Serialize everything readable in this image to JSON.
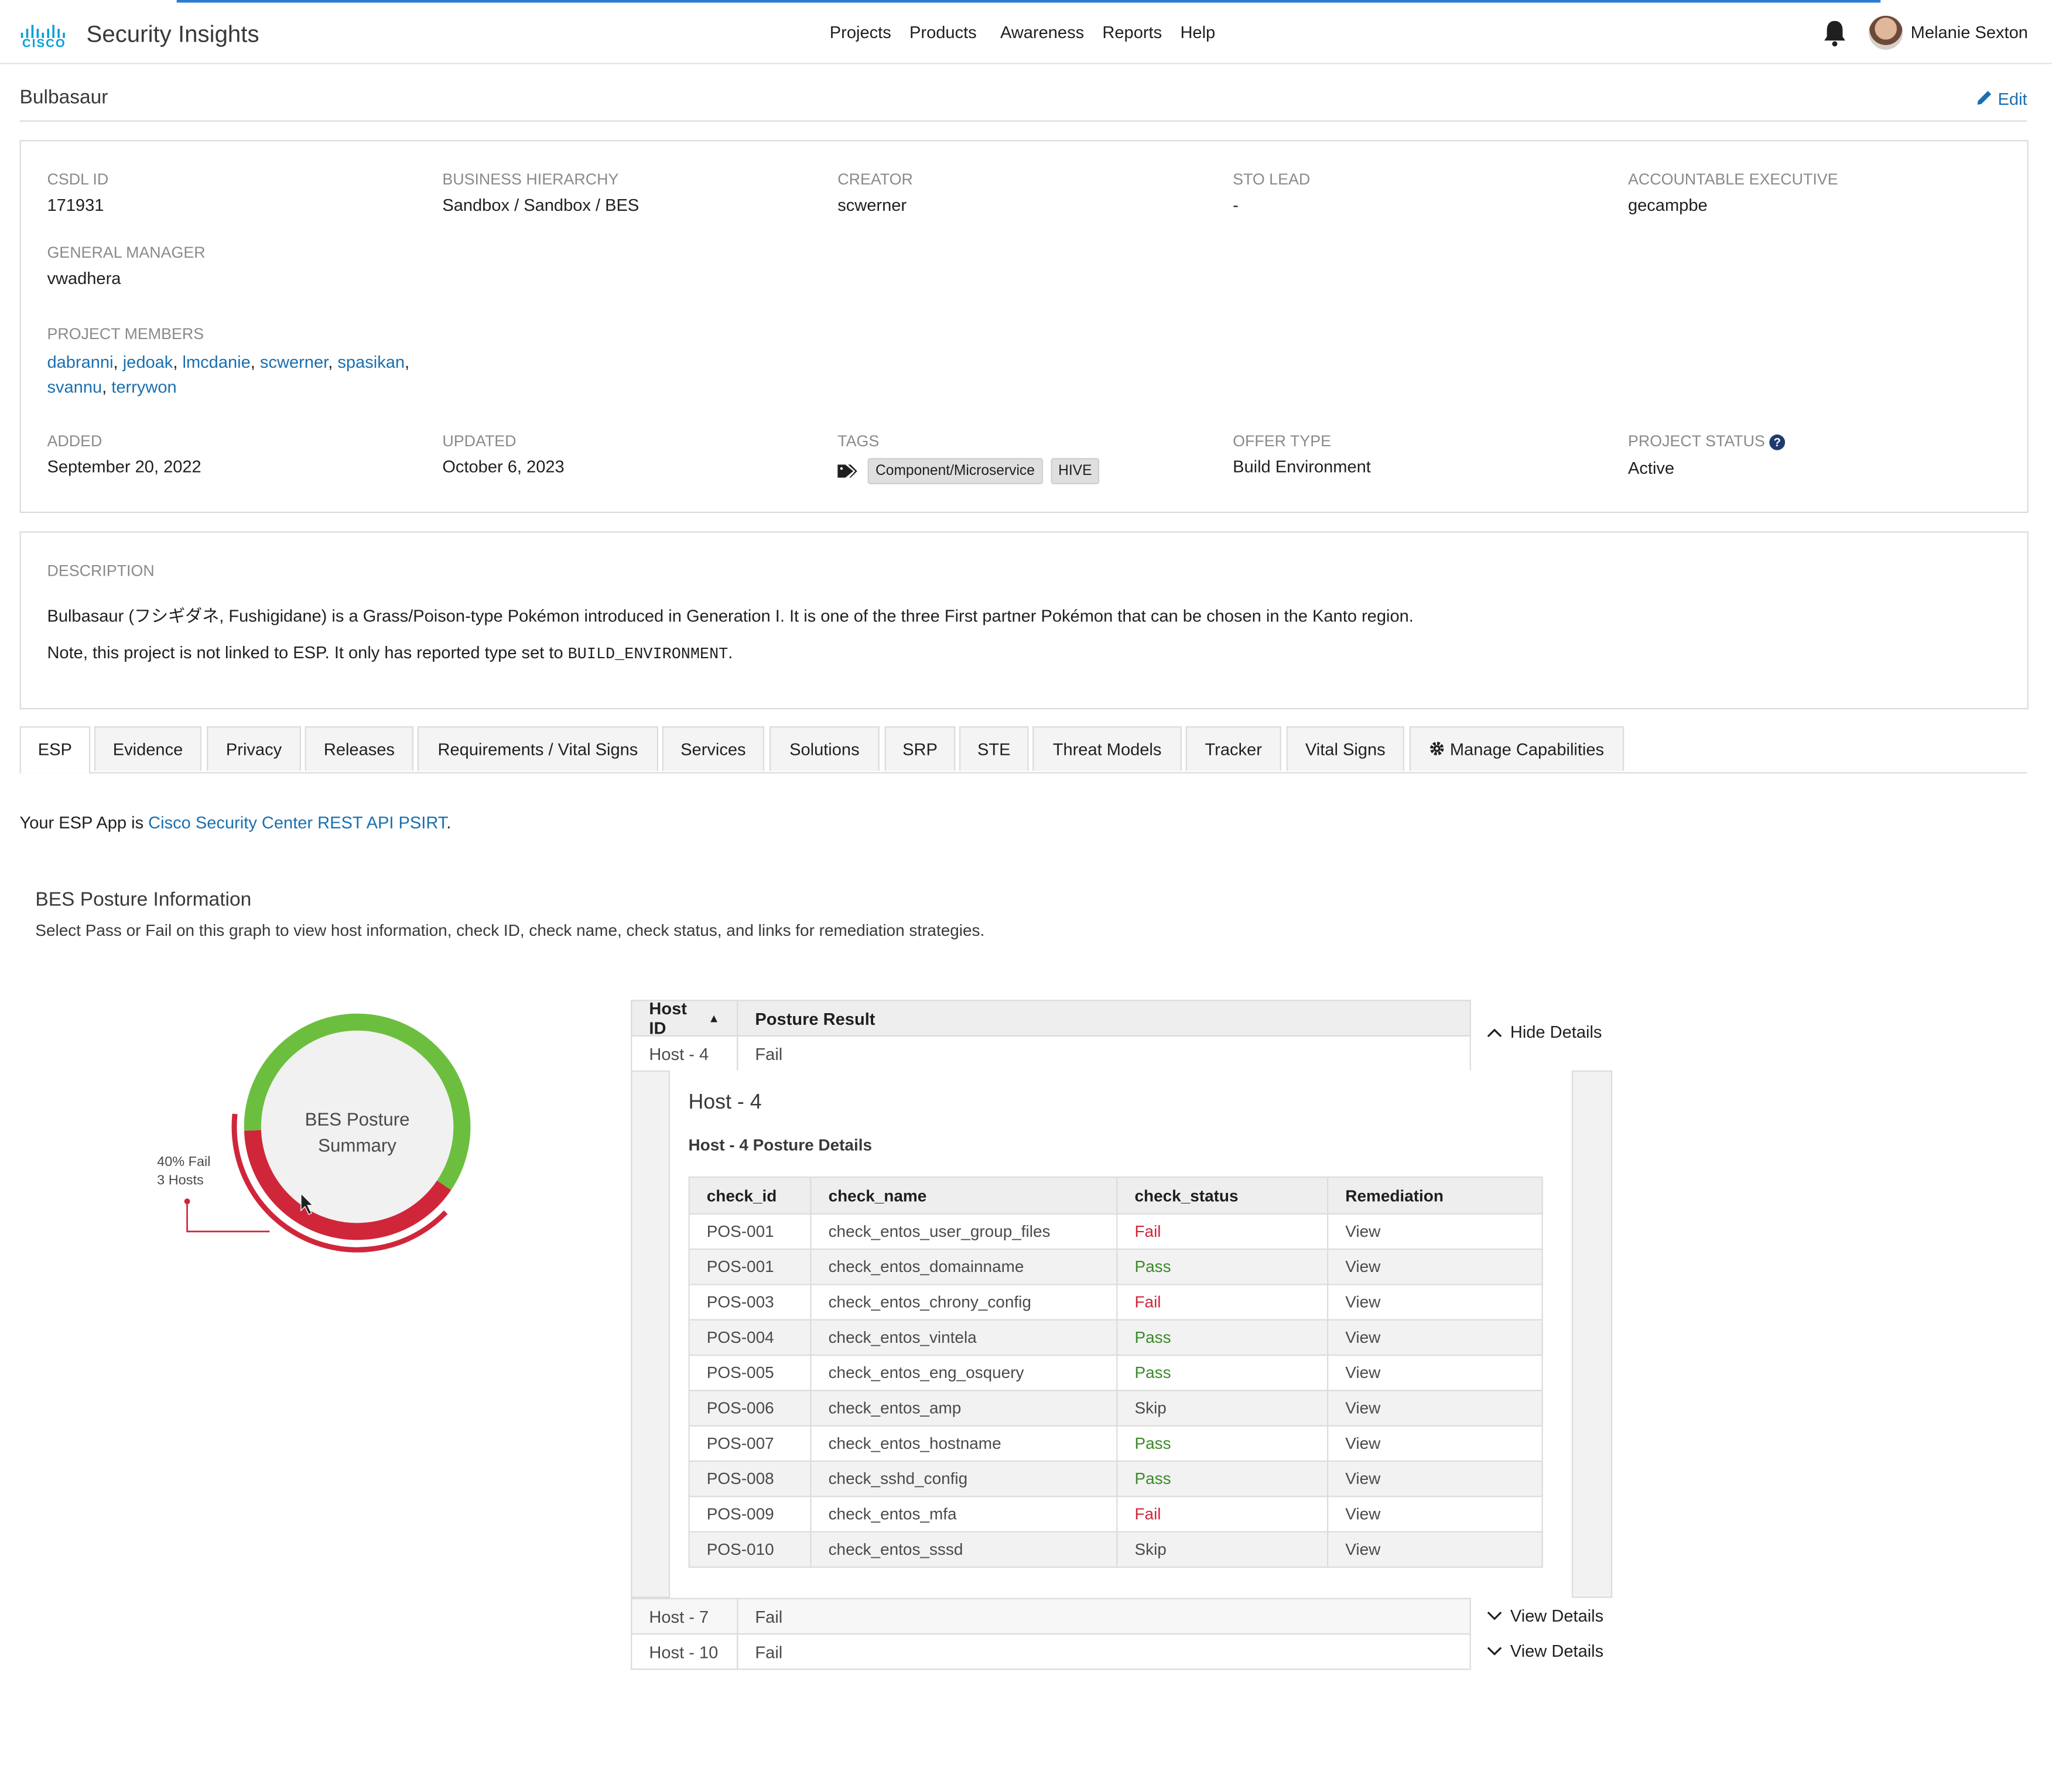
{
  "header": {
    "logo_text": "CISCO",
    "app_title": "Security Insights",
    "nav": [
      "Projects",
      "Products",
      "Awareness",
      "Reports",
      "Help"
    ],
    "user_name": "Melanie Sexton",
    "bell_icon": "bell-icon"
  },
  "project": {
    "title": "Bulbasaur",
    "edit_label": "Edit",
    "fields": {
      "csdl_id_label": "CSDL ID",
      "csdl_id": "171931",
      "business_label": "BUSINESS HIERARCHY",
      "business": "Sandbox / Sandbox / BES",
      "creator_label": "CREATOR",
      "creator": "scwerner",
      "sto_label": "STO LEAD",
      "sto": "-",
      "exec_label": "ACCOUNTABLE EXECUTIVE",
      "exec": "gecampbe",
      "gm_label": "GENERAL MANAGER",
      "gm": "vwadhera",
      "members_label": "PROJECT MEMBERS",
      "members": [
        "dabranni",
        "jedoak",
        "lmcdanie",
        "scwerner",
        "spasikan",
        "svannu",
        "terrywon"
      ],
      "added_label": "ADDED",
      "added": "September 20, 2022",
      "updated_label": "UPDATED",
      "updated": "October 6, 2023",
      "tags_label": "TAGS",
      "tags": [
        "Component/Microservice",
        "HIVE"
      ],
      "offer_label": "OFFER TYPE",
      "offer": "Build Environment",
      "status_label": "PROJECT STATUS",
      "status": "Active"
    },
    "description": {
      "label": "DESCRIPTION",
      "line1": "Bulbasaur (フシギダネ, Fushigidane) is a Grass/Poison-type Pokémon introduced in Generation I. It is one of the three First partner Pokémon that can be chosen in the Kanto region.",
      "line2_prefix": "Note, this project is not linked to ESP. It only has reported type set to ",
      "line2_code": "BUILD_ENVIRONMENT",
      "line2_suffix": "."
    }
  },
  "tabs": [
    "ESP",
    "Evidence",
    "Privacy",
    "Releases",
    "Requirements / Vital Signs",
    "Services",
    "Solutions",
    "SRP",
    "STE",
    "Threat Models",
    "Tracker",
    "Vital Signs",
    "Manage Capabilities"
  ],
  "esp": {
    "prefix": "Your ESP App is ",
    "app_link": "Cisco Security Center REST API PSIRT",
    "suffix": "."
  },
  "bes": {
    "title": "BES Posture Information",
    "subtitle": "Select Pass or Fail on this graph to view host information, check ID, check name, check status, and links for remediation strategies.",
    "donut_center": [
      "BES Posture",
      "Summary"
    ],
    "fail_label": "40% Fail",
    "fail_hosts": "3 Hosts",
    "colors": {
      "pass": "#6cbf3e",
      "fail": "#d0263a"
    },
    "fail_fraction": 0.4
  },
  "host_table": {
    "headers": [
      "Host ID",
      "Posture Result"
    ],
    "hide_label": "Hide Details",
    "view_label": "View Details",
    "rows": [
      {
        "host": "Host - 4",
        "result": "Fail"
      },
      {
        "host": "Host - 7",
        "result": "Fail"
      },
      {
        "host": "Host - 10",
        "result": "Fail"
      }
    ]
  },
  "host_detail": {
    "title": "Host - 4",
    "subtitle": "Host - 4 Posture Details",
    "headers": [
      "check_id",
      "check_name",
      "check_status",
      "Remediation"
    ],
    "rows": [
      {
        "id": "POS-001",
        "name": "check_entos_user_group_files",
        "status": "Fail",
        "link": "View"
      },
      {
        "id": "POS-001",
        "name": "check_entos_domainname",
        "status": "Pass",
        "link": "View"
      },
      {
        "id": "POS-003",
        "name": "check_entos_chrony_config",
        "status": "Fail",
        "link": "View"
      },
      {
        "id": "POS-004",
        "name": "check_entos_vintela",
        "status": "Pass",
        "link": "View"
      },
      {
        "id": "POS-005",
        "name": "check_entos_eng_osquery",
        "status": "Pass",
        "link": "View"
      },
      {
        "id": "POS-006",
        "name": "check_entos_amp",
        "status": "Skip",
        "link": "View"
      },
      {
        "id": "POS-007",
        "name": "check_entos_hostname",
        "status": "Pass",
        "link": "View"
      },
      {
        "id": "POS-008",
        "name": "check_sshd_config",
        "status": "Pass",
        "link": "View"
      },
      {
        "id": "POS-009",
        "name": "check_entos_mfa",
        "status": "Fail",
        "link": "View"
      },
      {
        "id": "POS-010",
        "name": "check_entos_sssd",
        "status": "Skip",
        "link": "View"
      }
    ]
  }
}
